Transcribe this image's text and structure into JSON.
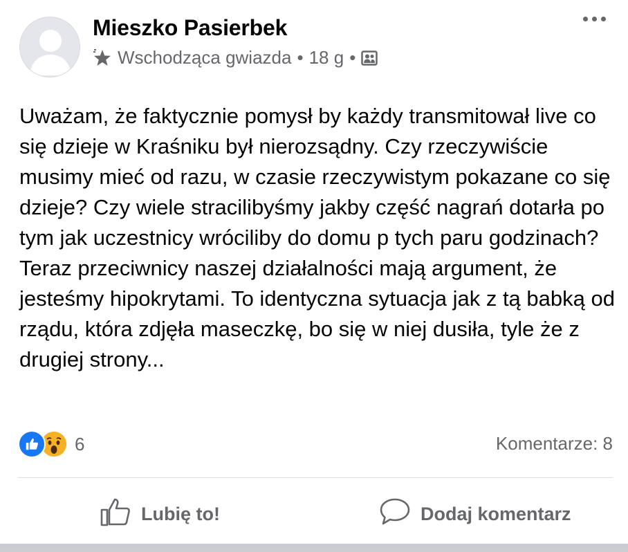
{
  "post": {
    "author": "Mieszko Pasierbek",
    "badge": "Wschodząca gwiazda",
    "separator": "•",
    "time": "18 g",
    "text": "Uważam, że faktycznie pomysł by każdy transmitował live co się dzieje w Kraśniku był nierozsądny. Czy rzeczywiście musimy mieć od razu, w czasie rzeczywistym pokazane co się dzieje? Czy wiele stracilibyśmy jakby część nagrań dotarła po tym jak uczestnicy wróciliby do domu p tych paru godzinach? Teraz przeciwnicy naszej działalności mają argument, że jesteśmy hipokrytami. To identyczna sytuacja jak z tą babką od rządu, która zdjęła maseczkę, bo się w niej dusiła, tyle że z drugiej strony...",
    "reaction_count": "6",
    "reaction_icons": [
      "like-icon",
      "wow-icon"
    ],
    "comments_label": "Komentarze: 8",
    "privacy_icon": "group-icon",
    "badge_icon": "star-icon"
  },
  "actions": {
    "like_label": "Lubię to!",
    "comment_label": "Dodaj komentarz"
  },
  "colors": {
    "text": "#050505",
    "secondary": "#65676b",
    "like_blue": "#1877f2",
    "wow_yellow": "#f7b125",
    "divider": "#dcdde1"
  }
}
